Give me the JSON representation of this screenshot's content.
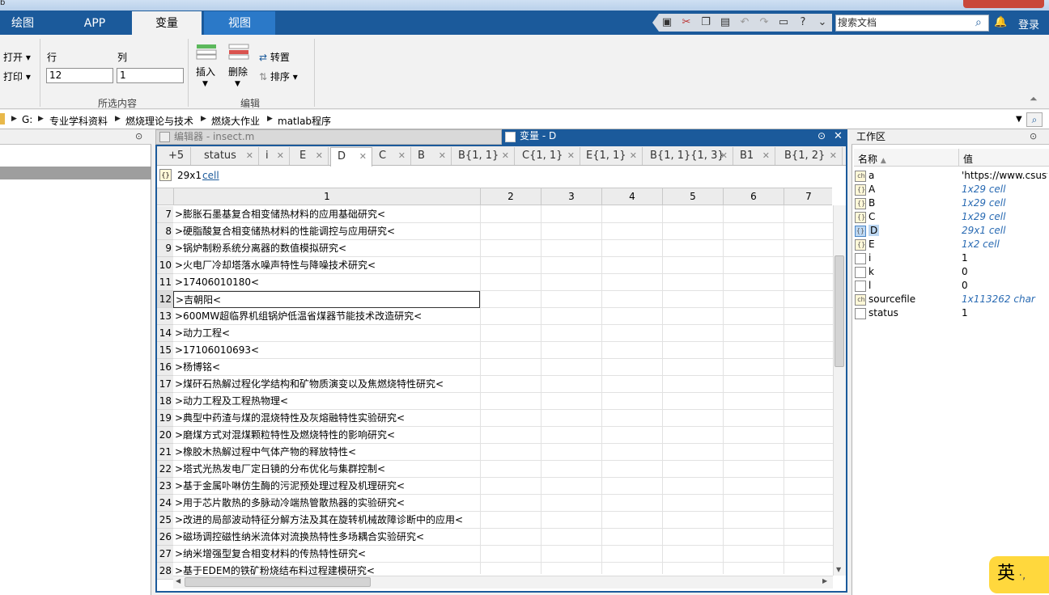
{
  "window": {
    "title_fragment": "b"
  },
  "ribbon_tabs": [
    "绘图",
    "APP",
    "变量",
    "视图"
  ],
  "search": {
    "placeholder": "搜索文档"
  },
  "login": "登录",
  "ribbon": {
    "open": "打开",
    "print": "打印",
    "row_label": "行",
    "col_label": "列",
    "row_value": "12",
    "col_value": "1",
    "selection_group": "所选内容",
    "insert": "插入",
    "delete": "删除",
    "transpose": "转置",
    "sort": "排序",
    "edit_group": "编辑"
  },
  "breadcrumb": [
    "G:",
    "专业学科资料",
    "燃烧理论与技术",
    "燃烧大作业",
    "matlab程序"
  ],
  "editor_tab": "编辑器 - insect.m",
  "variable_tab": "变量 - D",
  "subtabs": [
    "+5",
    "status",
    "i",
    "E",
    "D",
    "C",
    "B",
    "B{1, 1}",
    "C{1, 1}",
    "E{1, 1}",
    "B{1, 1}{1, 3}",
    "B1",
    "B{1, 2}"
  ],
  "var_info": {
    "size": "29x1",
    "class": "cell"
  },
  "columns": [
    "1",
    "2",
    "3",
    "4",
    "5",
    "6",
    "7"
  ],
  "rows": [
    {
      "n": "7",
      "v": ">膨胀石墨基复合相变储热材料的应用基础研究<"
    },
    {
      "n": "8",
      "v": ">硬脂酸复合相变储热材料的性能调控与应用研究<"
    },
    {
      "n": "9",
      "v": ">锅炉制粉系统分离器的数值模拟研究<"
    },
    {
      "n": "10",
      "v": ">火电厂冷却塔落水噪声特性与降噪技术研究<"
    },
    {
      "n": "11",
      "v": ">17406010180<"
    },
    {
      "n": "12",
      "v": ">吉朝阳<"
    },
    {
      "n": "13",
      "v": ">600MW超临界机组锅炉低温省煤器节能技术改造研究<"
    },
    {
      "n": "14",
      "v": ">动力工程<"
    },
    {
      "n": "15",
      "v": ">17106010693<"
    },
    {
      "n": "16",
      "v": ">杨博铭<"
    },
    {
      "n": "17",
      "v": ">煤矸石热解过程化学结构和矿物质演变以及焦燃烧特性研究<"
    },
    {
      "n": "18",
      "v": ">动力工程及工程热物理<"
    },
    {
      "n": "19",
      "v": ">典型中药渣与煤的混烧特性及灰熔融特性实验研究<"
    },
    {
      "n": "20",
      "v": ">磨煤方式对混煤颗粒特性及燃烧特性的影响研究<"
    },
    {
      "n": "21",
      "v": ">橡胶木热解过程中气体产物的释放特性<"
    },
    {
      "n": "22",
      "v": ">塔式光热发电厂定日镜的分布优化与集群控制<"
    },
    {
      "n": "23",
      "v": ">基于金属卟啉仿生酶的污泥预处理过程及机理研究<"
    },
    {
      "n": "24",
      "v": ">用于芯片散热的多脉动冷端热管散热器的实验研究<"
    },
    {
      "n": "25",
      "v": ">改进的局部波动特征分解方法及其在旋转机械故障诊断中的应用<"
    },
    {
      "n": "26",
      "v": ">磁场调控磁性纳米流体对流换热特性多场耦合实验研究<"
    },
    {
      "n": "27",
      "v": ">纳米增强型复合相变材料的传热特性研究<"
    },
    {
      "n": "28",
      "v": ">基于EDEM的铁矿粉烧结布料过程建模研究<"
    }
  ],
  "selected_row": "12",
  "workspace": {
    "title": "工作区",
    "col_name": "名称",
    "col_value": "值",
    "vars": [
      {
        "name": "a",
        "value": "'https://www.csust",
        "italic": false,
        "kind": "char"
      },
      {
        "name": "A",
        "value": "1x29 cell",
        "italic": true,
        "kind": "cell"
      },
      {
        "name": "B",
        "value": "1x29 cell",
        "italic": true,
        "kind": "cell"
      },
      {
        "name": "C",
        "value": "1x29 cell",
        "italic": true,
        "kind": "cell"
      },
      {
        "name": "D",
        "value": "29x1 cell",
        "italic": true,
        "kind": "cell-selected"
      },
      {
        "name": "E",
        "value": "1x2 cell",
        "italic": true,
        "kind": "cell"
      },
      {
        "name": "i",
        "value": "1",
        "italic": false,
        "kind": "num"
      },
      {
        "name": "k",
        "value": "0",
        "italic": false,
        "kind": "num"
      },
      {
        "name": "l",
        "value": "0",
        "italic": false,
        "kind": "num"
      },
      {
        "name": "sourcefile",
        "value": "1x113262 char",
        "italic": true,
        "kind": "char"
      },
      {
        "name": "status",
        "value": "1",
        "italic": false,
        "kind": "num"
      }
    ]
  },
  "ime": "英"
}
